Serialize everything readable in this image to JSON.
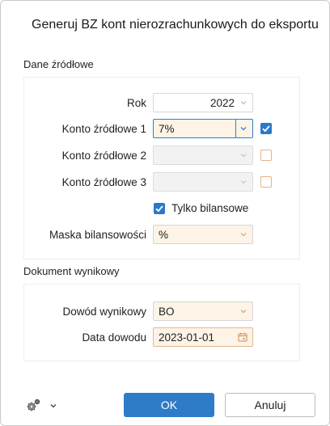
{
  "dialog": {
    "title": "Generuj BZ kont nierozrachunkowych do eksportu"
  },
  "source_section": {
    "label": "Dane źródłowe",
    "rok": {
      "label": "Rok",
      "value": "2022"
    },
    "konto1": {
      "label": "Konto źródłowe 1",
      "value": "7%",
      "checked": true
    },
    "konto2": {
      "label": "Konto źródłowe 2",
      "value": "",
      "checked": false
    },
    "konto3": {
      "label": "Konto źródłowe 3",
      "value": "",
      "checked": false
    },
    "tylko_bilansowe": {
      "label": "Tylko bilansowe",
      "checked": true
    },
    "maska": {
      "label": "Maska bilansowości",
      "value": "%"
    }
  },
  "result_section": {
    "label": "Dokument wynikowy",
    "dowod": {
      "label": "Dowód wynikowy",
      "value": "BO"
    },
    "data": {
      "label": "Data dowodu",
      "value": "2023-01-01"
    }
  },
  "footer": {
    "ok_label": "OK",
    "cancel_label": "Anuluj",
    "settings_icon": "gear-icon"
  },
  "colors": {
    "accent": "#2e7cc8",
    "field_tint": "#fdf3e6",
    "checkbox_off_border": "#e4b38a"
  }
}
